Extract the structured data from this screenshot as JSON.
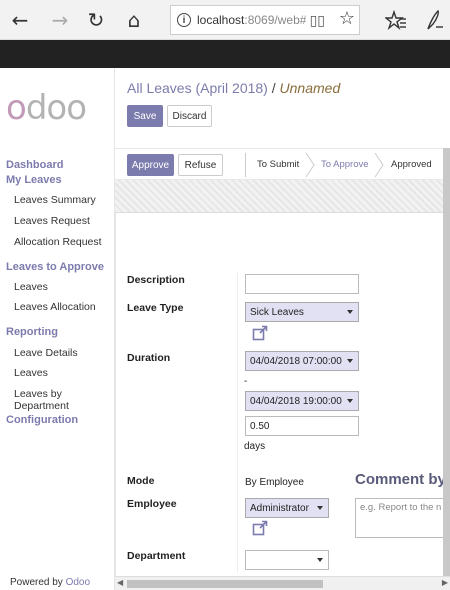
{
  "browser": {
    "url_host": "localhost",
    "url_rest": ":8069/web#",
    "back_glyph": "←",
    "forward_glyph": "→",
    "refresh_glyph": "↻",
    "home_glyph": "⌂"
  },
  "sidebar": {
    "logo": "odoo",
    "sections": [
      {
        "header": "Dashboard"
      },
      {
        "header": "My Leaves",
        "items": [
          "Leaves Summary",
          "Leaves Request",
          "Allocation Request"
        ]
      },
      {
        "header": "Leaves to Approve",
        "items": [
          "Leaves",
          "Leaves Allocation"
        ]
      },
      {
        "header": "Reporting",
        "items": [
          "Leave Details",
          "Leaves",
          "Leaves by Department"
        ]
      },
      {
        "header": "Configuration"
      }
    ],
    "powered_prefix": "Powered by ",
    "powered_brand": "Odoo"
  },
  "header": {
    "breadcrumb_parent": "All Leaves (April 2018)",
    "breadcrumb_sep": " / ",
    "breadcrumb_current": "Unnamed",
    "save_label": "Save",
    "discard_label": "Discard"
  },
  "statusbar": {
    "approve_label": "Approve",
    "refuse_label": "Refuse",
    "stages": [
      "To Submit",
      "To Approve",
      "Approved"
    ],
    "active_stage": "To Approve"
  },
  "form": {
    "description_label": "Description",
    "description_value": "",
    "leave_type_label": "Leave Type",
    "leave_type_value": "Sick Leaves",
    "duration_label": "Duration",
    "date_from": "04/04/2018 07:00:00",
    "date_sep": "-",
    "date_to": "04/04/2018 19:00:00",
    "days_value": "0.50",
    "days_unit": "days",
    "mode_label": "Mode",
    "mode_value": "By Employee",
    "employee_label": "Employee",
    "employee_value": "Administrator",
    "department_label": "Department",
    "department_value": "",
    "comment_title": "Comment by",
    "comment_placeholder": "e.g. Report to the n"
  },
  "colors": {
    "brand": "#7c7bad",
    "selected_field": "#e1e1f3",
    "breadcrumb_current": "#8a6d3b"
  }
}
